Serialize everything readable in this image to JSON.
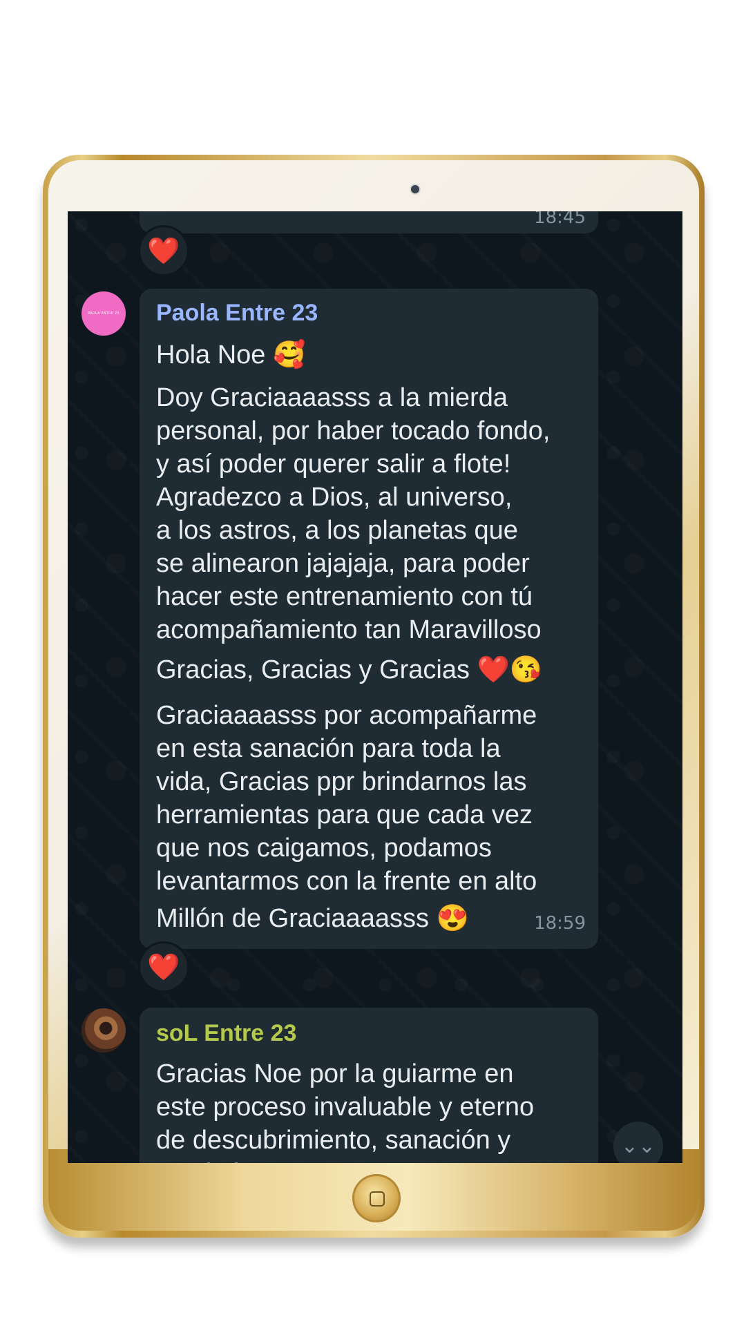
{
  "chat": {
    "previous_message": {
      "time": "18:45",
      "reaction": "❤️"
    },
    "messages": [
      {
        "sender": "Paola Entre 23",
        "sender_color": "#9ab6ff",
        "avatar_text": "PAOLA ENTRE 23",
        "line1": "Hola Noe 🥰",
        "line2": "Doy Graciaaaasss a la mierda\npersonal, por haber tocado fondo,\ny así poder querer salir a flote!\nAgradezco a Dios, al universo,\na los astros, a los planetas que\nse alinearon jajajaja, para poder\nhacer este entrenamiento con tú\nacompañamiento tan Maravilloso",
        "line3": "Gracias, Gracias y Gracias ❤️😘",
        "line4": "Graciaaaasss por acompañarme\nen esta sanación para toda la\nvida, Gracias ppr brindarnos las\nherramientas para que cada vez\nque nos caigamos, podamos\nlevantarmos con la frente en alto",
        "line5": "Millón de Graciaaaasss 😍",
        "time": "18:59",
        "reaction": "❤️"
      },
      {
        "sender": "soL Entre 23",
        "sender_color": "#b5c94a",
        "text": "Gracias Noe por la guiarme en\neste proceso invaluable y eterno\nde descubrimiento, sanación y\ncrecimiento"
      }
    ],
    "scroll_down_icon": "double-chevron-down-icon",
    "colors": {
      "background": "#0f171e",
      "bubble": "#1f2c34",
      "text": "#e9edef",
      "timestamp": "#8696a0",
      "reaction": "#e11d2f"
    }
  }
}
